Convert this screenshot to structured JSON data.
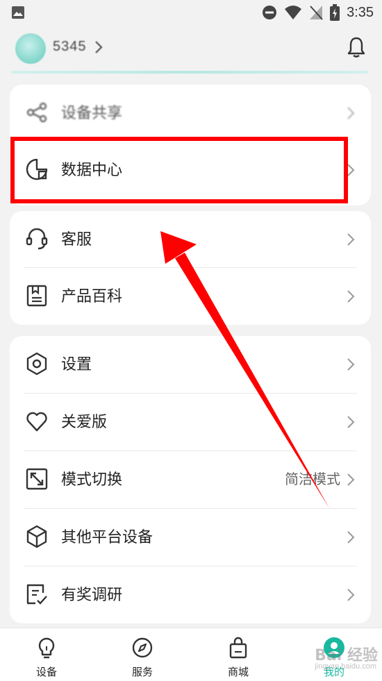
{
  "status_bar": {
    "time": "3:35"
  },
  "profile": {
    "username": "5345"
  },
  "menu_group_1": [
    {
      "label": "设备共享"
    },
    {
      "label": "数据中心"
    }
  ],
  "menu_group_2": [
    {
      "label": "客服"
    },
    {
      "label": "产品百科"
    }
  ],
  "menu_group_3": [
    {
      "label": "设置"
    },
    {
      "label": "关爱版"
    },
    {
      "label": "模式切换",
      "value": "简洁模式"
    },
    {
      "label": "其他平台设备"
    },
    {
      "label": "有奖调研"
    }
  ],
  "tab_bar": [
    {
      "label": "设备",
      "icon": "bulb-icon"
    },
    {
      "label": "服务",
      "icon": "compass-icon"
    },
    {
      "label": "商城",
      "icon": "bag-icon"
    },
    {
      "label": "我的",
      "icon": "profile-icon",
      "active": true
    }
  ],
  "watermark": {
    "text": "Bai 经验",
    "sub": "jingyan.baidu.com"
  },
  "colors": {
    "accent": "#1bb8a0",
    "highlight": "#ff0000"
  }
}
